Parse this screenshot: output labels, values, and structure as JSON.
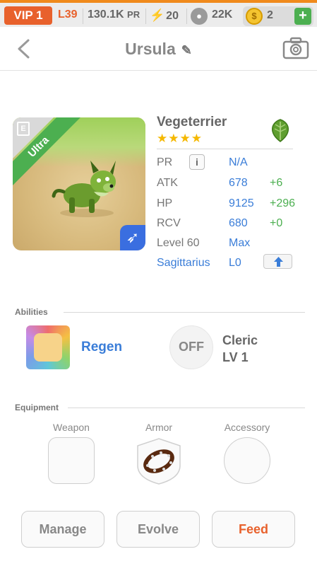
{
  "topbar": {
    "vip": "VIP 1",
    "level": "L39",
    "pr_value": "130.1K",
    "pr_unit": "PR",
    "energy": "20",
    "paws": "22K",
    "coins": "2",
    "plus": "+",
    "accent_color": "#e8612c"
  },
  "header": {
    "title": "Ursula"
  },
  "pet": {
    "rarity": "Ultra",
    "corner_badge": "E",
    "name": "Vegeterrier",
    "stars": "★★★★",
    "star_count": 4,
    "element_icon": "leaf-icon",
    "stats": [
      {
        "label": "PR",
        "value": "N/A",
        "bonus": "",
        "info": "i"
      },
      {
        "label": "ATK",
        "value": "678",
        "bonus": "+6"
      },
      {
        "label": "HP",
        "value": "9125",
        "bonus": "+296"
      },
      {
        "label": "RCV",
        "value": "680",
        "bonus": "+0"
      },
      {
        "label": "Level 60",
        "value": "Max",
        "bonus": ""
      }
    ],
    "sign": {
      "label": "Sagittarius",
      "value": "L0"
    }
  },
  "abilities": {
    "title": "Abilities",
    "primary": {
      "name": "Regen"
    },
    "secondary": {
      "state": "OFF",
      "name": "Cleric",
      "level": "LV 1"
    }
  },
  "equipment": {
    "title": "Equipment",
    "slots": [
      {
        "label": "Weapon"
      },
      {
        "label": "Armor"
      },
      {
        "label": "Accessory"
      }
    ]
  },
  "actions": {
    "manage": "Manage",
    "evolve": "Evolve",
    "feed": "Feed"
  }
}
